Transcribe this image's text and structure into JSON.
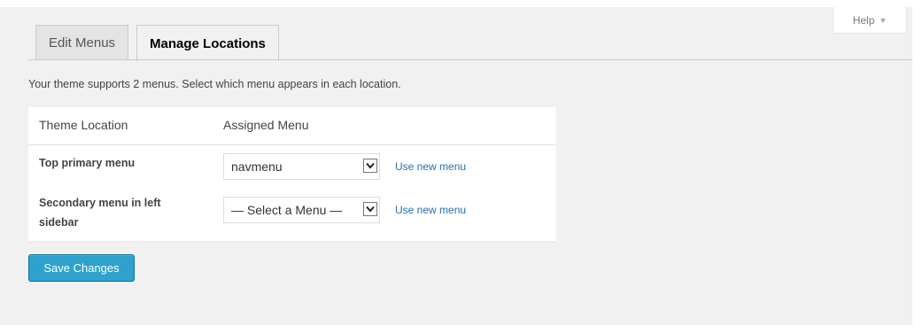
{
  "help": {
    "label": "Help"
  },
  "tabs": [
    {
      "label": "Edit Menus"
    },
    {
      "label": "Manage Locations"
    }
  ],
  "intro_text": "Your theme supports 2 menus. Select which menu appears in each location.",
  "table": {
    "headers": [
      "Theme Location",
      "Assigned Menu"
    ],
    "rows": [
      {
        "location": "Top primary menu",
        "selected": "navmenu",
        "link": "Use new menu"
      },
      {
        "location": "Secondary menu in left sidebar",
        "selected": "— Select a Menu —",
        "link": "Use new menu"
      }
    ]
  },
  "save_label": "Save Changes",
  "colors": {
    "link": "#2271b1",
    "button": "#2ea2cc",
    "button_border": "#0074a2",
    "background": "#f1f1f1"
  }
}
